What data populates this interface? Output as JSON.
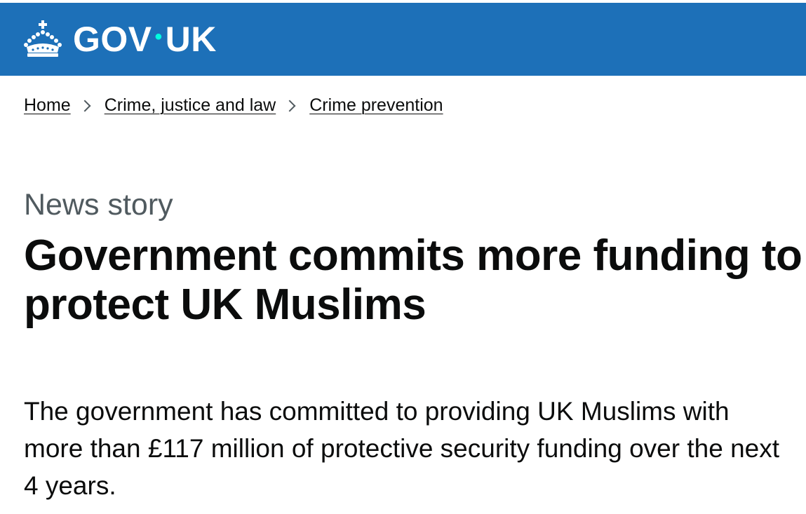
{
  "header": {
    "logo_text_left": "GOV",
    "logo_dot": "•",
    "logo_text_right": "UK",
    "crown_icon": "crown-icon",
    "background_color": "#1d70b8",
    "dot_color": "#00ffe0"
  },
  "breadcrumbs": {
    "items": [
      {
        "label": "Home"
      },
      {
        "label": "Crime, justice and law"
      },
      {
        "label": "Crime prevention"
      }
    ],
    "separator_icon": "chevron-right-icon"
  },
  "article": {
    "caption": "News story",
    "title": "Government commits more funding to protect UK Muslims",
    "lead": "The government has committed to providing UK Muslims with more than £117 million of protective security funding over the next 4 years."
  }
}
